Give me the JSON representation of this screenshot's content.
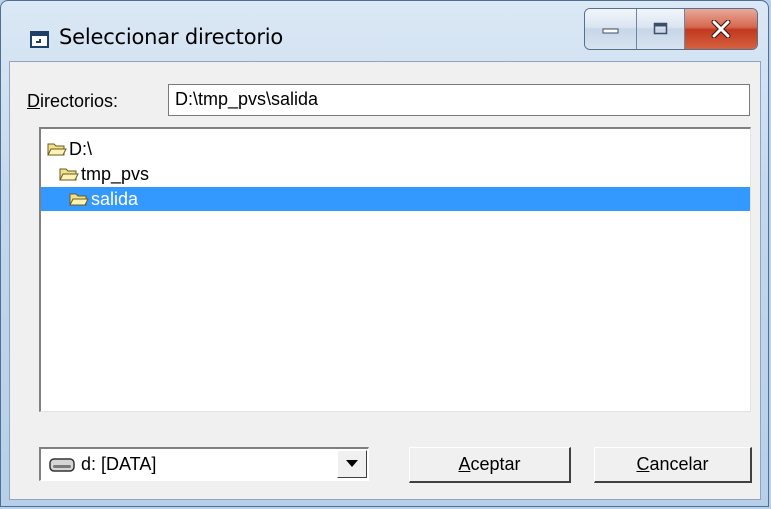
{
  "window": {
    "title": "Seleccionar directorio"
  },
  "directories": {
    "label": "Directorios:",
    "label_accesskey": "D",
    "label_rest": "irectorios:",
    "value": "D:\\tmp_pvs\\salida"
  },
  "tree": {
    "items": [
      {
        "label": "D:\\",
        "selected": false
      },
      {
        "label": "tmp_pvs",
        "selected": false
      },
      {
        "label": "salida",
        "selected": true
      }
    ]
  },
  "drive": {
    "selected": "d: [DATA]"
  },
  "buttons": {
    "accept": {
      "label": "Aceptar",
      "accesskey": "A",
      "rest": "ceptar"
    },
    "cancel": {
      "label": "Cancelar",
      "accesskey": "C",
      "rest": "ancelar"
    }
  },
  "colors": {
    "selection": "#3399ff",
    "title_bar": "#c3d8ee",
    "close_button": "#c2391f"
  },
  "icons": {
    "window": "dialog-window-icon",
    "folder_open": "open-folder-icon",
    "drive": "hard-drive-icon",
    "dropdown": "dropdown-arrow-icon"
  }
}
